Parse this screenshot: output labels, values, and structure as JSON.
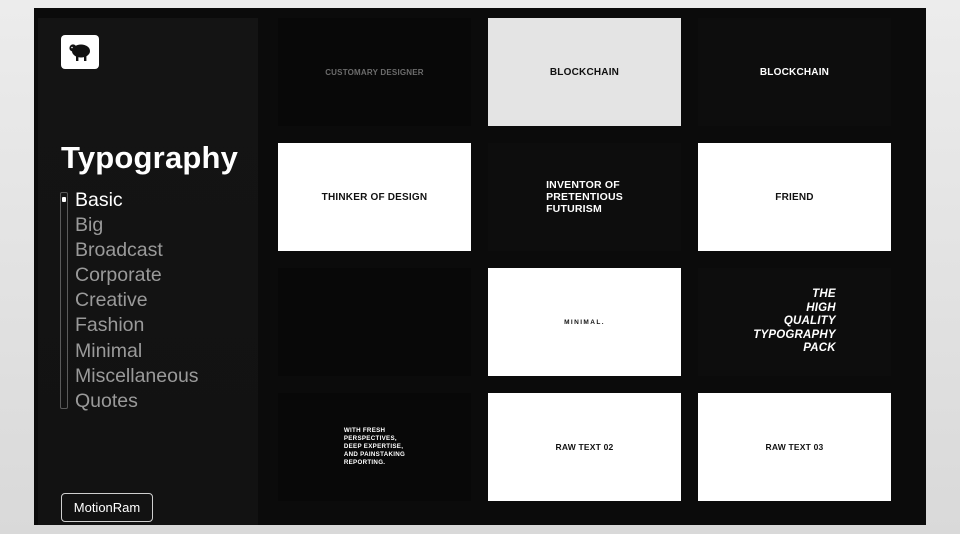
{
  "sidebar": {
    "title": "Typography",
    "categories": [
      "Basic",
      "Big",
      "Broadcast",
      "Corporate",
      "Creative",
      "Fashion",
      "Minimal",
      "Miscellaneous",
      "Quotes"
    ],
    "active_index": 0,
    "brand_button": "MotionRam",
    "logo_icon": "sheep-icon"
  },
  "cards": [
    {
      "text": "CUSTOMARY DESIGNER",
      "theme": "dark"
    },
    {
      "text": "BLOCKCHAIN",
      "theme": "grey"
    },
    {
      "text": "BLOCKCHAIN",
      "theme": "dark"
    },
    {
      "text": "THINKER OF DESIGN",
      "theme": "white"
    },
    {
      "text": "INVENTOR OF\nPRETENTIOUS\nFUTURISM",
      "theme": "dark"
    },
    {
      "text": "FRIEND",
      "theme": "white"
    },
    {
      "text": "",
      "theme": "dark"
    },
    {
      "text": "MINIMAL.",
      "theme": "white"
    },
    {
      "text": "THE\nHIGH\nQUALITY\nTYPOGRAPHY\nPACK",
      "theme": "dark"
    },
    {
      "text": "WITH FRESH\nPERSPECTIVES,\nDEEP EXPERTISE,\nAND PAINSTAKING\nREPORTING.",
      "theme": "dark"
    },
    {
      "text": "RAW TEXT 02",
      "theme": "white"
    },
    {
      "text": "RAW TEXT 03",
      "theme": "white"
    }
  ],
  "colors": {
    "app_bg": "#0b0b0b",
    "sidebar_bg": "#141414",
    "inactive_text": "#9a9a9a",
    "active_text": "#ffffff"
  }
}
